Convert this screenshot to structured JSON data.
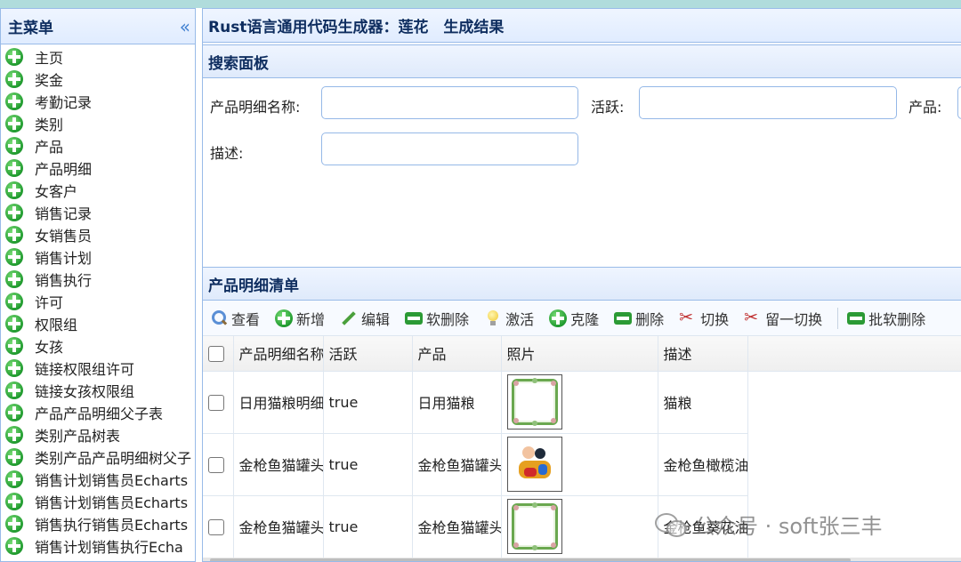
{
  "sidebar": {
    "title": "主菜单",
    "collapse_icon": "«",
    "items": [
      {
        "label": "主页"
      },
      {
        "label": "奖金"
      },
      {
        "label": "考勤记录"
      },
      {
        "label": "类别"
      },
      {
        "label": "产品"
      },
      {
        "label": "产品明细"
      },
      {
        "label": "女客户"
      },
      {
        "label": "销售记录"
      },
      {
        "label": "女销售员"
      },
      {
        "label": "销售计划"
      },
      {
        "label": "销售执行"
      },
      {
        "label": "许可"
      },
      {
        "label": "权限组"
      },
      {
        "label": "女孩"
      },
      {
        "label": "链接权限组许可"
      },
      {
        "label": "链接女孩权限组"
      },
      {
        "label": "产品产品明细父子表"
      },
      {
        "label": "类别产品树表"
      },
      {
        "label": "类别产品产品明细树父子"
      },
      {
        "label": "销售计划销售员Echarts"
      },
      {
        "label": "销售计划销售员Echarts"
      },
      {
        "label": "销售执行销售员Echarts"
      },
      {
        "label": "销售计划销售执行Echa"
      }
    ]
  },
  "main": {
    "title": "Rust语言通用代码生成器：莲花　生成结果",
    "search_panel": {
      "title": "搜索面板",
      "fields": {
        "detail_name_label": "产品明细名称:",
        "active_label": "活跃:",
        "product_label": "产品:",
        "description_label": "描述:"
      }
    },
    "list_panel": {
      "title": "产品明细清单",
      "toolbar": {
        "view": "查看",
        "add": "新增",
        "edit": "编辑",
        "soft_delete": "软删除",
        "activate": "激活",
        "clone": "克隆",
        "delete": "删除",
        "toggle": "切换",
        "keep_one_toggle": "留一切换",
        "batch_soft_delete": "批软删除"
      },
      "columns": {
        "name": "产品明细名称",
        "active": "活跃",
        "product": "产品",
        "photo": "照片",
        "description": "描述"
      },
      "rows": [
        {
          "name": "日用猫粮明细",
          "active": "true",
          "product": "日用猫粮",
          "photo": "frame",
          "description": "猫粮"
        },
        {
          "name": "金枪鱼猫罐头",
          "active": "true",
          "product": "金枪鱼猫罐头",
          "photo": "kids",
          "description": "金枪鱼橄榄油"
        },
        {
          "name": "金枪鱼猫罐头",
          "active": "true",
          "product": "金枪鱼猫罐头",
          "photo": "frame",
          "description": "金枪鱼葵花油"
        }
      ]
    }
  },
  "watermark": {
    "text": "公众号 · soft张三丰"
  }
}
